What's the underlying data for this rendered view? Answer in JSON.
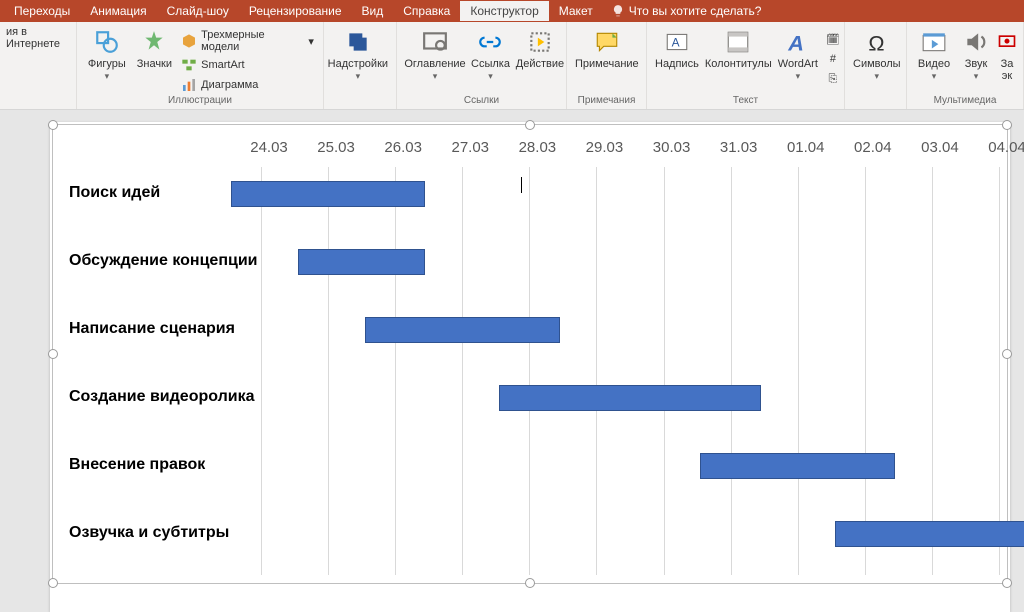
{
  "tabs": {
    "items": [
      "Переходы",
      "Анимация",
      "Слайд-шоу",
      "Рецензирование",
      "Вид",
      "Справка",
      "Конструктор",
      "Макет"
    ],
    "active_index": 6,
    "tell_me": "Что вы хотите сделать?"
  },
  "ribbon": {
    "left_partial": "ия в Интернете",
    "shapes": "Фигуры",
    "icons": "Значки",
    "models3d": "Трехмерные модели",
    "smartart": "SmartArt",
    "chart": "Диаграмма",
    "group_illustr": "Иллюстрации",
    "addins": "Надстройки",
    "toc": "Оглавление",
    "link": "Ссылка",
    "action": "Действие",
    "group_links": "Ссылки",
    "comment": "Примечание",
    "group_comments": "Примечания",
    "textbox": "Надпись",
    "headerfooter": "Колонтитулы",
    "wordart": "WordArt",
    "group_text": "Текст",
    "symbols": "Символы",
    "video": "Видео",
    "audio": "Звук",
    "group_media": "Мультимедиа",
    "rec_partial": "За\nэк"
  },
  "chart_data": {
    "type": "bar",
    "orientation": "horizontal-gantt",
    "dates": [
      "24.03",
      "25.03",
      "26.03",
      "27.03",
      "28.03",
      "29.03",
      "30.03",
      "31.03",
      "01.04",
      "02.04",
      "03.04",
      "04.04"
    ],
    "tasks": [
      {
        "label": "Поиск идей",
        "start": "24.03",
        "end": "26.03",
        "start_idx": 0,
        "span": 3
      },
      {
        "label": "Обсуждение концепции",
        "start": "25.03",
        "end": "26.03",
        "start_idx": 1,
        "span": 2
      },
      {
        "label": "Написание сценария",
        "start": "26.03",
        "end": "28.03",
        "start_idx": 2,
        "span": 3
      },
      {
        "label": "Создание видеоролика",
        "start": "28.03",
        "end": "31.03",
        "start_idx": 4,
        "span": 4
      },
      {
        "label": "Внесение правок",
        "start": "31.03",
        "end": "02.04",
        "start_idx": 7,
        "span": 3
      },
      {
        "label": "Озвучка и субтитры",
        "start": "02.04",
        "end": "04.04",
        "start_idx": 9,
        "span": 3
      }
    ],
    "bar_color": "#4472c4"
  }
}
